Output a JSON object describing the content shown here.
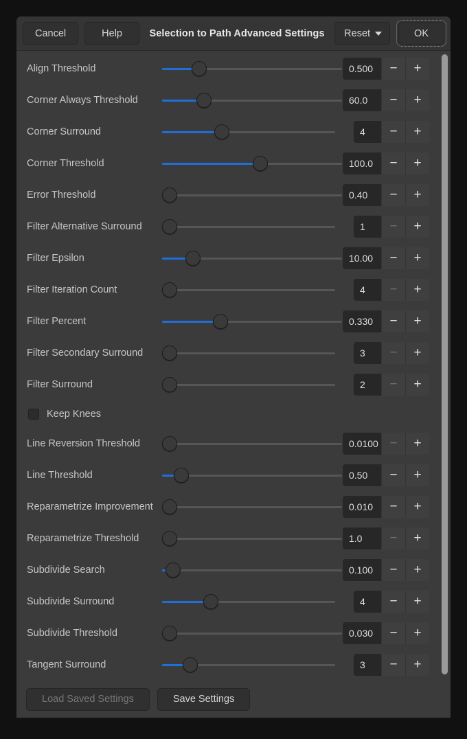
{
  "header": {
    "cancel_label": "Cancel",
    "help_label": "Help",
    "title": "Selection to Path Advanced Settings",
    "reset_label": "Reset",
    "ok_label": "OK"
  },
  "footer": {
    "load_label": "Load Saved Settings",
    "save_label": "Save Settings"
  },
  "spin_icons": {
    "minus": "−",
    "plus": "+"
  },
  "checkbox": {
    "label": "Keep Knees",
    "checked": false
  },
  "colors": {
    "accent": "#1e6fd9",
    "dialog_bg": "#3b3b3b",
    "header_bg": "#353535",
    "entry_bg": "#272727",
    "button_bg": "#303030",
    "text": "#c6c6c6",
    "scrollbar_thumb": "#9a9a9a"
  },
  "rows": [
    {
      "label": "Align Threshold",
      "value": "0.500",
      "kind": "float",
      "pos": 18,
      "minus_enabled": true
    },
    {
      "label": "Corner Always Threshold",
      "value": "60.0",
      "kind": "float",
      "pos": 21,
      "minus_enabled": true
    },
    {
      "label": "Corner Surround",
      "value": "4",
      "kind": "int",
      "pos": 33,
      "minus_enabled": true
    },
    {
      "label": "Corner Threshold",
      "value": "100.0",
      "kind": "float",
      "pos": 55,
      "minus_enabled": true
    },
    {
      "label": "Error Threshold",
      "value": "0.40",
      "kind": "float",
      "pos": 0,
      "minus_enabled": true
    },
    {
      "label": "Filter Alternative Surround",
      "value": "1",
      "kind": "int",
      "pos": 0,
      "minus_enabled": false
    },
    {
      "label": "Filter Epsilon",
      "value": "10.00",
      "kind": "float",
      "pos": 14,
      "minus_enabled": true
    },
    {
      "label": "Filter Iteration Count",
      "value": "4",
      "kind": "int",
      "pos": 0,
      "minus_enabled": false
    },
    {
      "label": "Filter Percent",
      "value": "0.330",
      "kind": "float",
      "pos": 31,
      "minus_enabled": true
    },
    {
      "label": "Filter Secondary Surround",
      "value": "3",
      "kind": "int",
      "pos": 0,
      "minus_enabled": false
    },
    {
      "label": "Filter Surround",
      "value": "2",
      "kind": "int",
      "pos": 0,
      "minus_enabled": false
    },
    {
      "label": "Line Reversion Threshold",
      "value": "0.0100",
      "kind": "float",
      "pos": 0,
      "minus_enabled": false
    },
    {
      "label": "Line Threshold",
      "value": "0.50",
      "kind": "float",
      "pos": 7,
      "minus_enabled": true
    },
    {
      "label": "Reparametrize Improvement",
      "value": "0.010",
      "kind": "float",
      "pos": 0,
      "minus_enabled": true
    },
    {
      "label": "Reparametrize Threshold",
      "value": "1.0",
      "kind": "float",
      "pos": 0,
      "minus_enabled": false
    },
    {
      "label": "Subdivide Search",
      "value": "0.100",
      "kind": "float",
      "pos": 2,
      "minus_enabled": true
    },
    {
      "label": "Subdivide Surround",
      "value": "4",
      "kind": "int",
      "pos": 26,
      "minus_enabled": true
    },
    {
      "label": "Subdivide Threshold",
      "value": "0.030",
      "kind": "float",
      "pos": 0,
      "minus_enabled": true
    },
    {
      "label": "Tangent Surround",
      "value": "3",
      "kind": "int",
      "pos": 13,
      "minus_enabled": true
    }
  ],
  "checkbox_after_row": 10
}
